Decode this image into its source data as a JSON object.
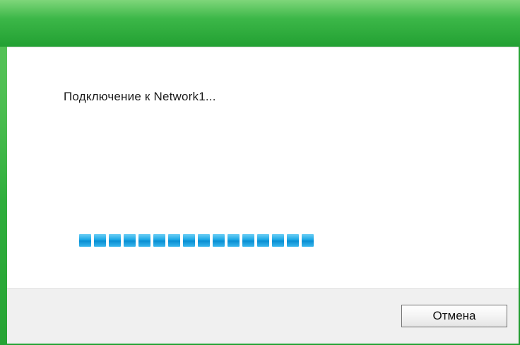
{
  "dialog": {
    "status_text": "Подключение к Network1...",
    "progress_segments": 16,
    "cancel_label": "Отмена"
  },
  "colors": {
    "frame_accent": "#2bb23a",
    "progress_segment": "#1aa7e6",
    "content_bg": "#ffffff",
    "footer_bg": "#f0f0f0"
  }
}
